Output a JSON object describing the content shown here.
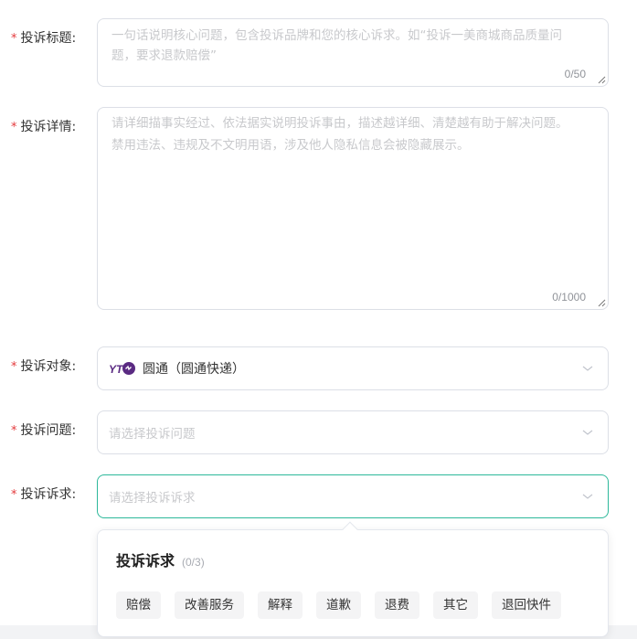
{
  "form": {
    "required_mark": "*",
    "title_field": {
      "label": "投诉标题:",
      "placeholder_line1": "一句话说明核心问题，包含投诉品牌和您的核心诉求。如“投诉一美商城商品质量问",
      "placeholder_line2": "题，要求退款赔偿”",
      "counter": "0/50"
    },
    "detail_field": {
      "label": "投诉详情:",
      "placeholder_line1": "请详细描事实经过、依法据实说明投诉事由，描述越详细、清楚越有助于解决问题。",
      "placeholder_line2": "禁用违法、违规及不文明用语，涉及他人隐私信息会被隐藏展示。",
      "counter": "0/1000"
    },
    "target_field": {
      "label": "投诉对象:",
      "value": "圆通（圆通快递）",
      "logo_text": "YT"
    },
    "issue_field": {
      "label": "投诉问题:",
      "placeholder": "请选择投诉问题"
    },
    "demand_field": {
      "label": "投诉诉求:",
      "placeholder": "请选择投诉诉求"
    }
  },
  "demand_popup": {
    "title": "投诉诉求",
    "count": "(0/3)",
    "options": [
      "赔偿",
      "改善服务",
      "解释",
      "道歉",
      "退费",
      "其它",
      "退回快件"
    ]
  },
  "colors": {
    "required": "#e4393c",
    "focus_border": "#2db89a",
    "placeholder": "#c8c9cc",
    "logo_purple": "#5a2a82"
  }
}
